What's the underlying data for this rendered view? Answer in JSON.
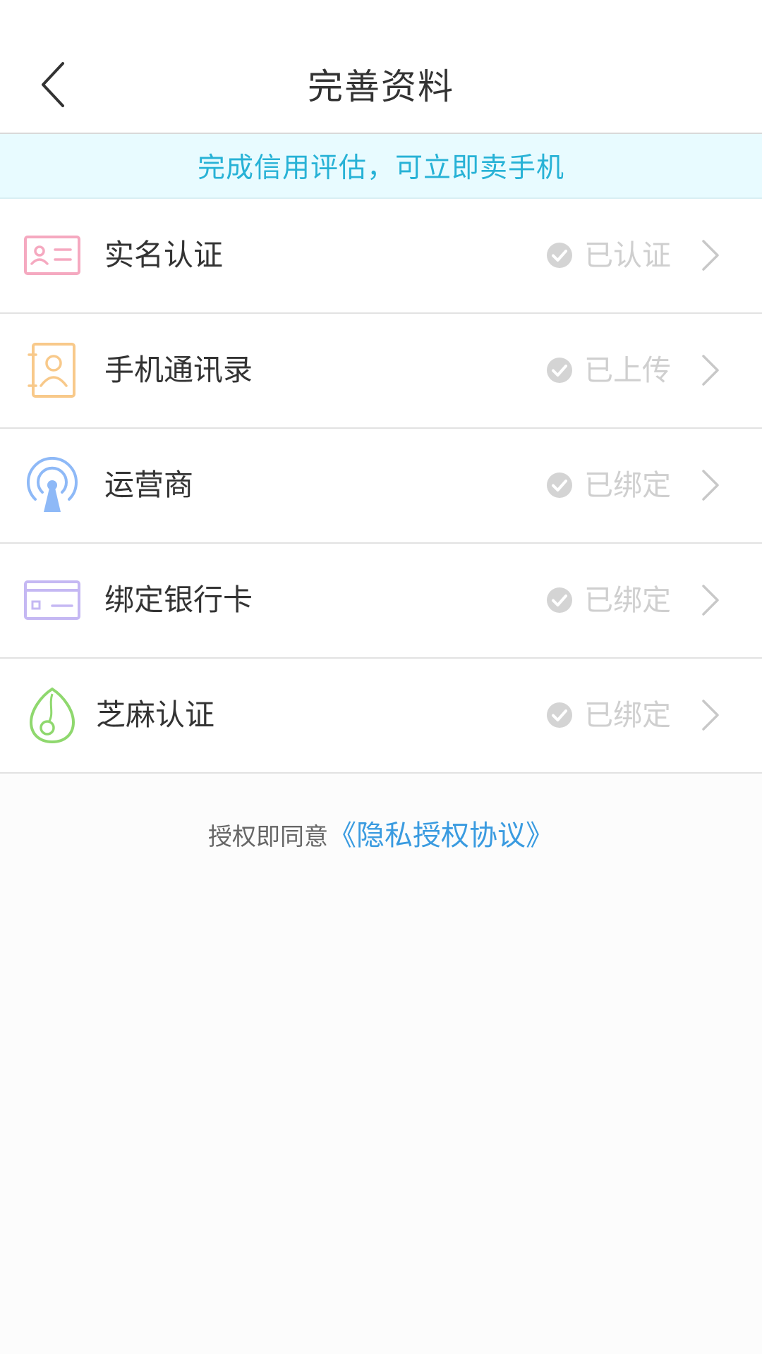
{
  "header": {
    "title": "完善资料",
    "back_icon": "chevron-left-icon"
  },
  "banner": {
    "text": "完成信用评估，可立即卖手机",
    "color": "#27b2d6",
    "background": "#e8fbff"
  },
  "items": [
    {
      "label": "实名认证",
      "status": "已认证",
      "icon": "id-card-icon",
      "icon_color": "#f5a9c0"
    },
    {
      "label": "手机通讯录",
      "status": "已上传",
      "icon": "contacts-book-icon",
      "icon_color": "#f8c98a"
    },
    {
      "label": "运营商",
      "status": "已绑定",
      "icon": "signal-tower-icon",
      "icon_color": "#8eb9f7"
    },
    {
      "label": "绑定银行卡",
      "status": "已绑定",
      "icon": "bank-card-icon",
      "icon_color": "#c5b8f3"
    },
    {
      "label": "芝麻认证",
      "status": "已绑定",
      "icon": "sesame-seed-icon",
      "icon_color": "#8fd86e"
    }
  ],
  "agreement": {
    "prefix": "授权即同意",
    "link": "《隐私授权协议》",
    "link_color": "#3a9be0"
  },
  "status_color": "#cfcfcf"
}
